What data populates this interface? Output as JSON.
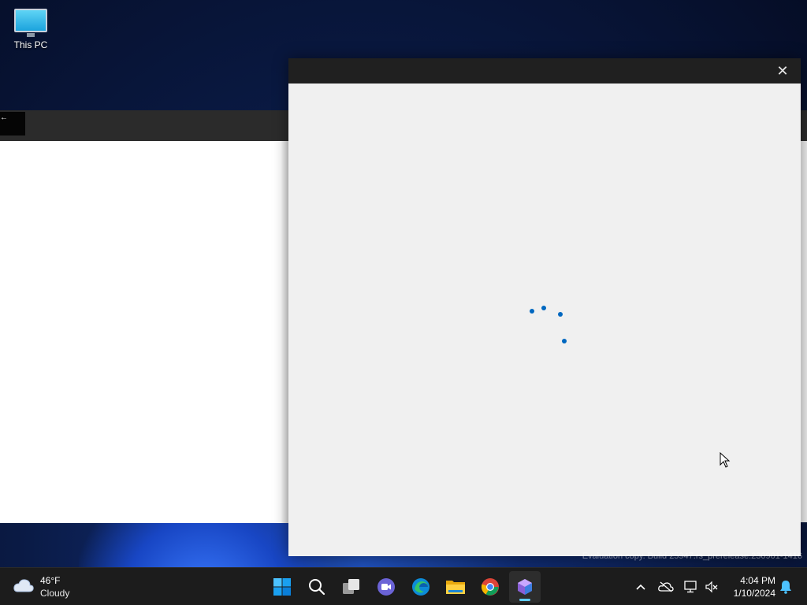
{
  "desktop": {
    "icons": [
      {
        "label": "This PC",
        "icon": "monitor-icon"
      }
    ]
  },
  "background_window": {
    "title_glyph": "←"
  },
  "dialog": {
    "title": "",
    "close_glyph": "✕",
    "state": "loading",
    "spinner_icon": "loading-spinner-icon"
  },
  "watermark": "Evaluation copy. Build 25947.rs_prerelease.230901-1416",
  "taskbar": {
    "weather": {
      "temperature": "46°F",
      "condition": "Cloudy",
      "icon": "cloud-icon"
    },
    "apps": [
      {
        "name": "Start",
        "icon": "windows-start-icon"
      },
      {
        "name": "Search",
        "icon": "search-icon"
      },
      {
        "name": "Task View",
        "icon": "task-view-icon"
      },
      {
        "name": "Teams Chat",
        "icon": "teams-chat-icon"
      },
      {
        "name": "Microsoft Edge",
        "icon": "edge-icon"
      },
      {
        "name": "File Explorer",
        "icon": "folder-icon"
      },
      {
        "name": "Google Chrome",
        "icon": "chrome-icon"
      },
      {
        "name": "Active App",
        "icon": "app-cube-icon",
        "active": true
      }
    ],
    "tray": {
      "icons": [
        "chevron-up-icon",
        "onedrive-icon",
        "network-icon",
        "volume-muted-icon",
        "notification-bell-icon"
      ],
      "time": "4:04 PM",
      "date": "1/10/2024"
    }
  },
  "colors": {
    "accent": "#0067c0",
    "taskbar": "#1c1c1c",
    "dialog_body": "#f0f0f0",
    "dialog_titlebar": "#202020"
  }
}
